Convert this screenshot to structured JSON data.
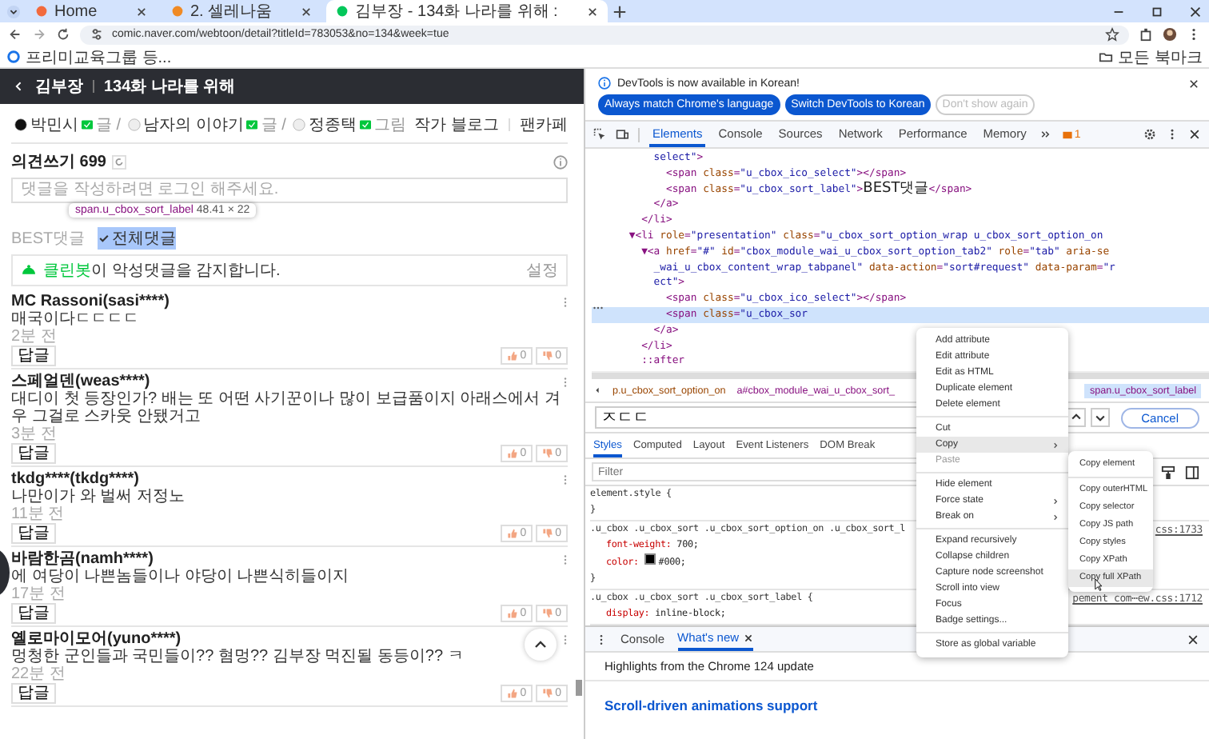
{
  "browser": {
    "tabs": [
      {
        "title": "Home",
        "selected": false,
        "color": "#f26a3d"
      },
      {
        "title": "2. 셀레나움",
        "selected": false,
        "color": "#f08a24"
      },
      {
        "title": "김부장 - 134화 나라를 위해 :",
        "selected": true,
        "color": "#03c75a"
      }
    ],
    "url": "comic.naver.com/webtoon/detail?titleId=783053&no=134&week=tue",
    "bookmark": "프리미교육그룹 등...",
    "all_bookmarks": "모든 북마크"
  },
  "page": {
    "series": "김부장",
    "episode": "134화 나라를 위해",
    "authors": [
      {
        "name": "박민시",
        "role": "글 /"
      },
      {
        "name": "남자의 이야기",
        "role": "글 /"
      },
      {
        "name": "정종택",
        "role": "그림"
      }
    ],
    "links": [
      "작가 블로그",
      "팬카페"
    ],
    "comments_title": "의견쓰기 699",
    "placeholder": "댓글을 작성하려면 로그인 해주세요.",
    "tooltip": {
      "selector": "span.u_cbox_sort_label",
      "size": "48.41 × 22"
    },
    "sorts": [
      {
        "label": "BEST댓글",
        "selected": false,
        "highlighted": false
      },
      {
        "label": "전체댓글",
        "selected": true,
        "highlighted": true
      }
    ],
    "cleanbot": {
      "name": "클린봇",
      "message": "이 악성댓글을 감지합니다.",
      "settings": "설정"
    },
    "comments": [
      {
        "author": "MC Rassoni(sasi****)",
        "text": "매국이다ㄷㄷㄷㄷ",
        "time": "2분 전",
        "reply": "답글",
        "likes": "0",
        "dislikes": "0"
      },
      {
        "author": "스페얼덴(weas****)",
        "text": "대디이 첫 등장인가? 배는 또 어떤 사기꾼이나 많이 보급품이지 아래스에서 겨우 그걸로 스카웃 안됐거고",
        "time": "3분 전",
        "reply": "답글",
        "likes": "0",
        "dislikes": "0"
      },
      {
        "author": "tkdg****(tkdg****)",
        "text": "나만이가 와 벌써 저정노",
        "time": "11분 전",
        "reply": "답글",
        "likes": "0",
        "dislikes": "0"
      },
      {
        "author": "바람한곰(namh****)",
        "text": "에 여당이 나쁜놈들이나 야당이 나쁜식히들이지",
        "time": "17분 전",
        "reply": "답글",
        "likes": "0",
        "dislikes": "0"
      },
      {
        "author": "옐로마이모어(yuno****)",
        "text": "멍청한 군인들과 국민들이?? 혐멍?? 김부장 먹진될 동등이?? ㅋ",
        "time": "22분 전",
        "reply": "답글",
        "likes": "0",
        "dislikes": "0"
      }
    ]
  },
  "devtools": {
    "notice": "DevTools is now available in Korean!",
    "notice_buttons": [
      {
        "label": "Always match Chrome's language",
        "kind": "primary"
      },
      {
        "label": "Switch DevTools to Korean",
        "kind": "primary"
      },
      {
        "label": "Don't show again",
        "kind": "outline"
      }
    ],
    "tabs": [
      {
        "label": "Elements",
        "selected": true
      },
      {
        "label": "Console",
        "selected": false
      },
      {
        "label": "Sources",
        "selected": false
      },
      {
        "label": "Network",
        "selected": false
      },
      {
        "label": "Performance",
        "selected": false
      },
      {
        "label": "Memory",
        "selected": false
      }
    ],
    "issues": "1",
    "code": [
      {
        "selected": false,
        "parts": [
          {
            "kind": "value",
            "text": "        select\""
          },
          {
            "kind": "tag",
            "text": ">"
          }
        ]
      },
      {
        "selected": false,
        "parts": [
          {
            "kind": "tag",
            "text": "          <span"
          },
          {
            "kind": "attr",
            "text": " class"
          },
          {
            "kind": "tag",
            "text": "="
          },
          {
            "kind": "value",
            "text": "\"u_cbox_ico_select\""
          },
          {
            "kind": "tag",
            "text": "></span>"
          }
        ]
      },
      {
        "selected": false,
        "parts": [
          {
            "kind": "tag",
            "text": "          <span"
          },
          {
            "kind": "attr",
            "text": " class"
          },
          {
            "kind": "tag",
            "text": "="
          },
          {
            "kind": "value",
            "text": "\"u_cbox_sort_label\""
          },
          {
            "kind": "tag",
            "text": ">"
          },
          {
            "kind": "text",
            "text": "BEST댓글"
          },
          {
            "kind": "tag",
            "text": "</span>"
          }
        ]
      },
      {
        "selected": false,
        "parts": [
          {
            "kind": "tag",
            "text": "        </a>"
          }
        ]
      },
      {
        "selected": false,
        "parts": [
          {
            "kind": "tag",
            "text": "      </li>"
          }
        ]
      },
      {
        "selected": false,
        "parts": [
          {
            "kind": "tag",
            "text": "    ▼<li"
          },
          {
            "kind": "attr",
            "text": " role"
          },
          {
            "kind": "tag",
            "text": "="
          },
          {
            "kind": "value",
            "text": "\"presentation\""
          },
          {
            "kind": "attr",
            "text": " class"
          },
          {
            "kind": "tag",
            "text": "="
          },
          {
            "kind": "value",
            "text": "\"u_cbox_sort_option_wrap u_cbox_sort_option_on"
          }
        ]
      },
      {
        "selected": false,
        "parts": [
          {
            "kind": "tag",
            "text": "      ▼<a"
          },
          {
            "kind": "attr",
            "text": " href"
          },
          {
            "kind": "tag",
            "text": "="
          },
          {
            "kind": "value",
            "text": "\"#\""
          },
          {
            "kind": "attr",
            "text": " id"
          },
          {
            "kind": "tag",
            "text": "="
          },
          {
            "kind": "value",
            "text": "\"cbox_module_wai_u_cbox_sort_option_tab2\""
          },
          {
            "kind": "attr",
            "text": " role"
          },
          {
            "kind": "tag",
            "text": "="
          },
          {
            "kind": "value",
            "text": "\"tab\""
          },
          {
            "kind": "attr",
            "text": " aria-se"
          }
        ]
      },
      {
        "selected": false,
        "parts": [
          {
            "kind": "value",
            "text": "        _wai_u_cbox_content_wrap_tabpanel\""
          },
          {
            "kind": "attr",
            "text": " data-action"
          },
          {
            "kind": "tag",
            "text": "="
          },
          {
            "kind": "value",
            "text": "\"sort#request\""
          },
          {
            "kind": "attr",
            "text": " data-param"
          },
          {
            "kind": "tag",
            "text": "="
          },
          {
            "kind": "value",
            "text": "\"r"
          }
        ]
      },
      {
        "selected": false,
        "parts": [
          {
            "kind": "value",
            "text": "        ect\""
          },
          {
            "kind": "tag",
            "text": ">"
          }
        ]
      },
      {
        "selected": false,
        "parts": [
          {
            "kind": "tag",
            "text": "          <span"
          },
          {
            "kind": "attr",
            "text": " class"
          },
          {
            "kind": "tag",
            "text": "="
          },
          {
            "kind": "value",
            "text": "\"u_cbox_ico_select\""
          },
          {
            "kind": "tag",
            "text": "></span>"
          }
        ]
      },
      {
        "selected": true,
        "parts": [
          {
            "kind": "tag",
            "text": "          <span"
          },
          {
            "kind": "attr",
            "text": " class"
          },
          {
            "kind": "tag",
            "text": "="
          },
          {
            "kind": "value",
            "text": "\"u_cbox_sor"
          }
        ]
      },
      {
        "selected": false,
        "parts": [
          {
            "kind": "tag",
            "text": "        </a>"
          }
        ]
      },
      {
        "selected": false,
        "parts": [
          {
            "kind": "tag",
            "text": "      </li>"
          }
        ]
      },
      {
        "selected": false,
        "parts": [
          {
            "kind": "tag",
            "text": "      ::after"
          }
        ]
      }
    ],
    "breadcrumbs": [
      {
        "label": "p.u_cbox_sort_option_on",
        "selected": false
      },
      {
        "label": "a#cbox_module_wai_u_cbox_sort_",
        "selected": false
      },
      {
        "label": "span.u_cbox_sort_label",
        "selected": true
      }
    ],
    "search": "ㅈㄷㄷ",
    "cancel": "Cancel",
    "style_tabs": [
      {
        "label": "Styles",
        "selected": true
      },
      {
        "label": "Computed",
        "selected": false
      },
      {
        "label": "Layout",
        "selected": false
      },
      {
        "label": "Event Listeners",
        "selected": false
      },
      {
        "label": "DOM Break",
        "selected": false
      }
    ],
    "filter_placeholder": "Filter",
    "rules": [
      {
        "selector": "element.style {",
        "close": "}"
      },
      {
        "selector": ".u_cbox .u_cbox_sort .u_cbox_sort_option_on .u_cbox_sort_l",
        "source": "css:1733",
        "declarations": [
          {
            "property": "font-weight:",
            "value": "700;"
          },
          {
            "property": "color:",
            "value": "#000;",
            "color": "#000000"
          }
        ],
        "close": "}"
      },
      {
        "selector": ".u_cbox .u_cbox_sort .u_cbox_sort_label {",
        "source": "pement_com⋯ew.css:1712",
        "declarations": [
          {
            "property": "display:",
            "value": "inline-block;"
          }
        ]
      }
    ],
    "drawer_tabs": [
      {
        "label": "Console",
        "selected": false,
        "closable": false
      },
      {
        "label": "What's new",
        "selected": true,
        "closable": true
      }
    ],
    "highlights": "Highlights from the Chrome 124 update",
    "feature": "Scroll-driven animations support",
    "menu": [
      [
        {
          "label": "Add attribute",
          "selected": false,
          "disabled": false,
          "submenu": false
        },
        {
          "label": "Edit attribute",
          "selected": false,
          "disabled": false,
          "submenu": false
        },
        {
          "label": "Edit as HTML",
          "selected": false,
          "disabled": false,
          "submenu": false
        },
        {
          "label": "Duplicate element",
          "selected": false,
          "disabled": false,
          "submenu": false
        },
        {
          "label": "Delete element",
          "selected": false,
          "disabled": false,
          "submenu": false
        }
      ],
      [
        {
          "label": "Cut",
          "selected": false,
          "disabled": false,
          "submenu": false
        },
        {
          "label": "Copy",
          "selected": true,
          "disabled": false,
          "submenu": true
        },
        {
          "label": "Paste",
          "selected": false,
          "disabled": true,
          "submenu": false
        }
      ],
      [
        {
          "label": "Hide element",
          "selected": false,
          "disabled": false,
          "submenu": false
        },
        {
          "label": "Force state",
          "selected": false,
          "disabled": false,
          "submenu": true
        },
        {
          "label": "Break on",
          "selected": false,
          "disabled": false,
          "submenu": true
        }
      ],
      [
        {
          "label": "Expand recursively",
          "selected": false,
          "disabled": false,
          "submenu": false
        },
        {
          "label": "Collapse children",
          "selected": false,
          "disabled": false,
          "submenu": false
        },
        {
          "label": "Capture node screenshot",
          "selected": false,
          "disabled": false,
          "submenu": false
        },
        {
          "label": "Scroll into view",
          "selected": false,
          "disabled": false,
          "submenu": false
        },
        {
          "label": "Focus",
          "selected": false,
          "disabled": false,
          "submenu": false
        },
        {
          "label": "Badge settings...",
          "selected": false,
          "disabled": false,
          "submenu": false
        }
      ],
      [
        {
          "label": "Store as global variable",
          "selected": false,
          "disabled": false,
          "submenu": false
        }
      ]
    ],
    "submenu": [
      [
        {
          "label": "Copy element",
          "selected": false
        }
      ],
      [
        {
          "label": "Copy outerHTML",
          "selected": false
        },
        {
          "label": "Copy selector",
          "selected": false
        },
        {
          "label": "Copy JS path",
          "selected": false
        },
        {
          "label": "Copy styles",
          "selected": false
        },
        {
          "label": "Copy XPath",
          "selected": false
        },
        {
          "label": "Copy full XPath",
          "selected": true
        }
      ]
    ]
  }
}
